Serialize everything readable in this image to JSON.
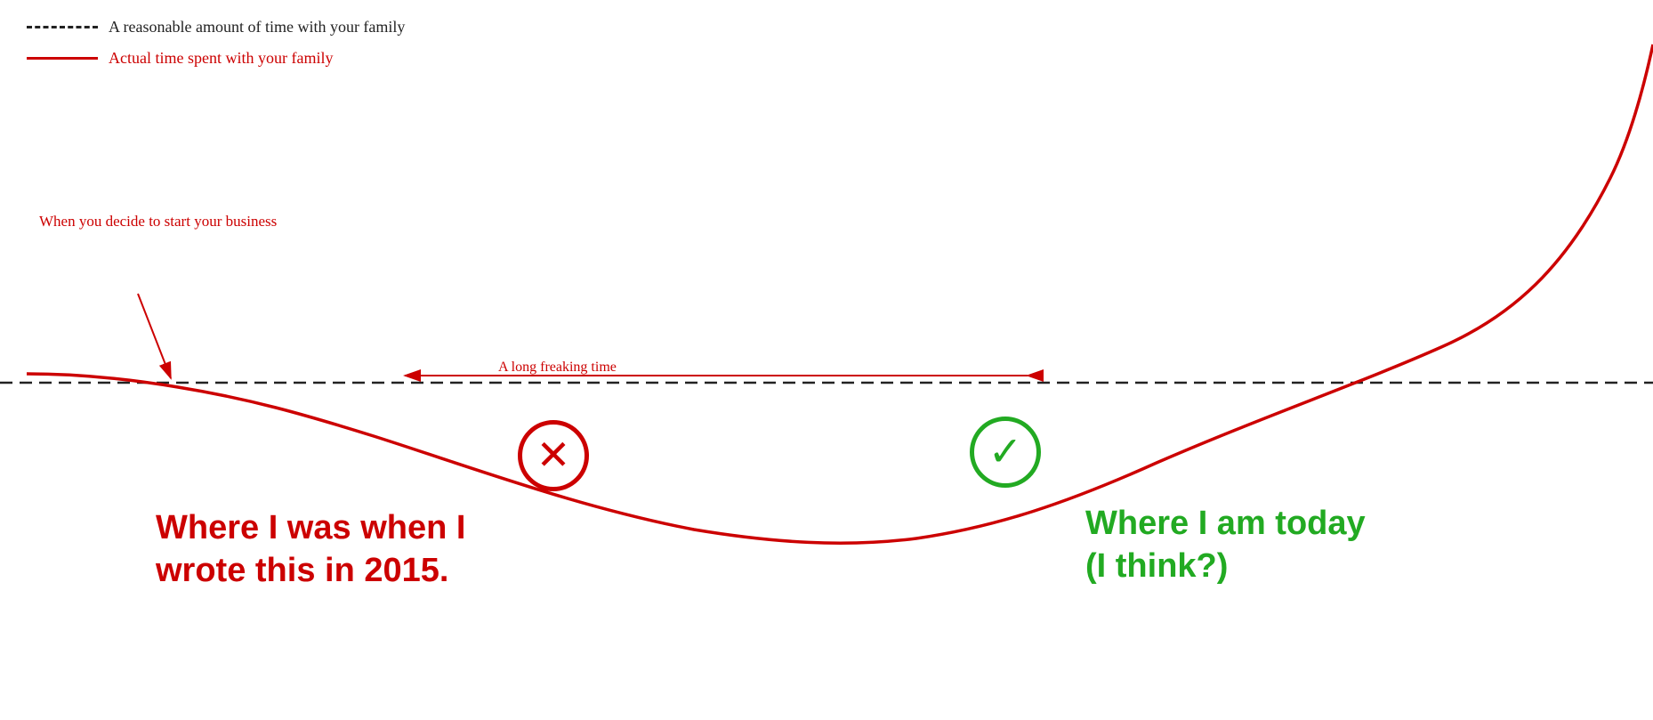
{
  "legend": {
    "dashed_label": "A reasonable amount of time with your family",
    "solid_label": "Actual time spent with your family"
  },
  "annotations": {
    "start_business": "When you decide to start your business",
    "long_time": "A long freaking time",
    "label_was": "Where I was when I\nwrote this in 2015.",
    "label_today": "Where I am today\n(I think?)"
  },
  "colors": {
    "red": "#cc0000",
    "green": "#22aa22",
    "dashed": "#222222"
  }
}
